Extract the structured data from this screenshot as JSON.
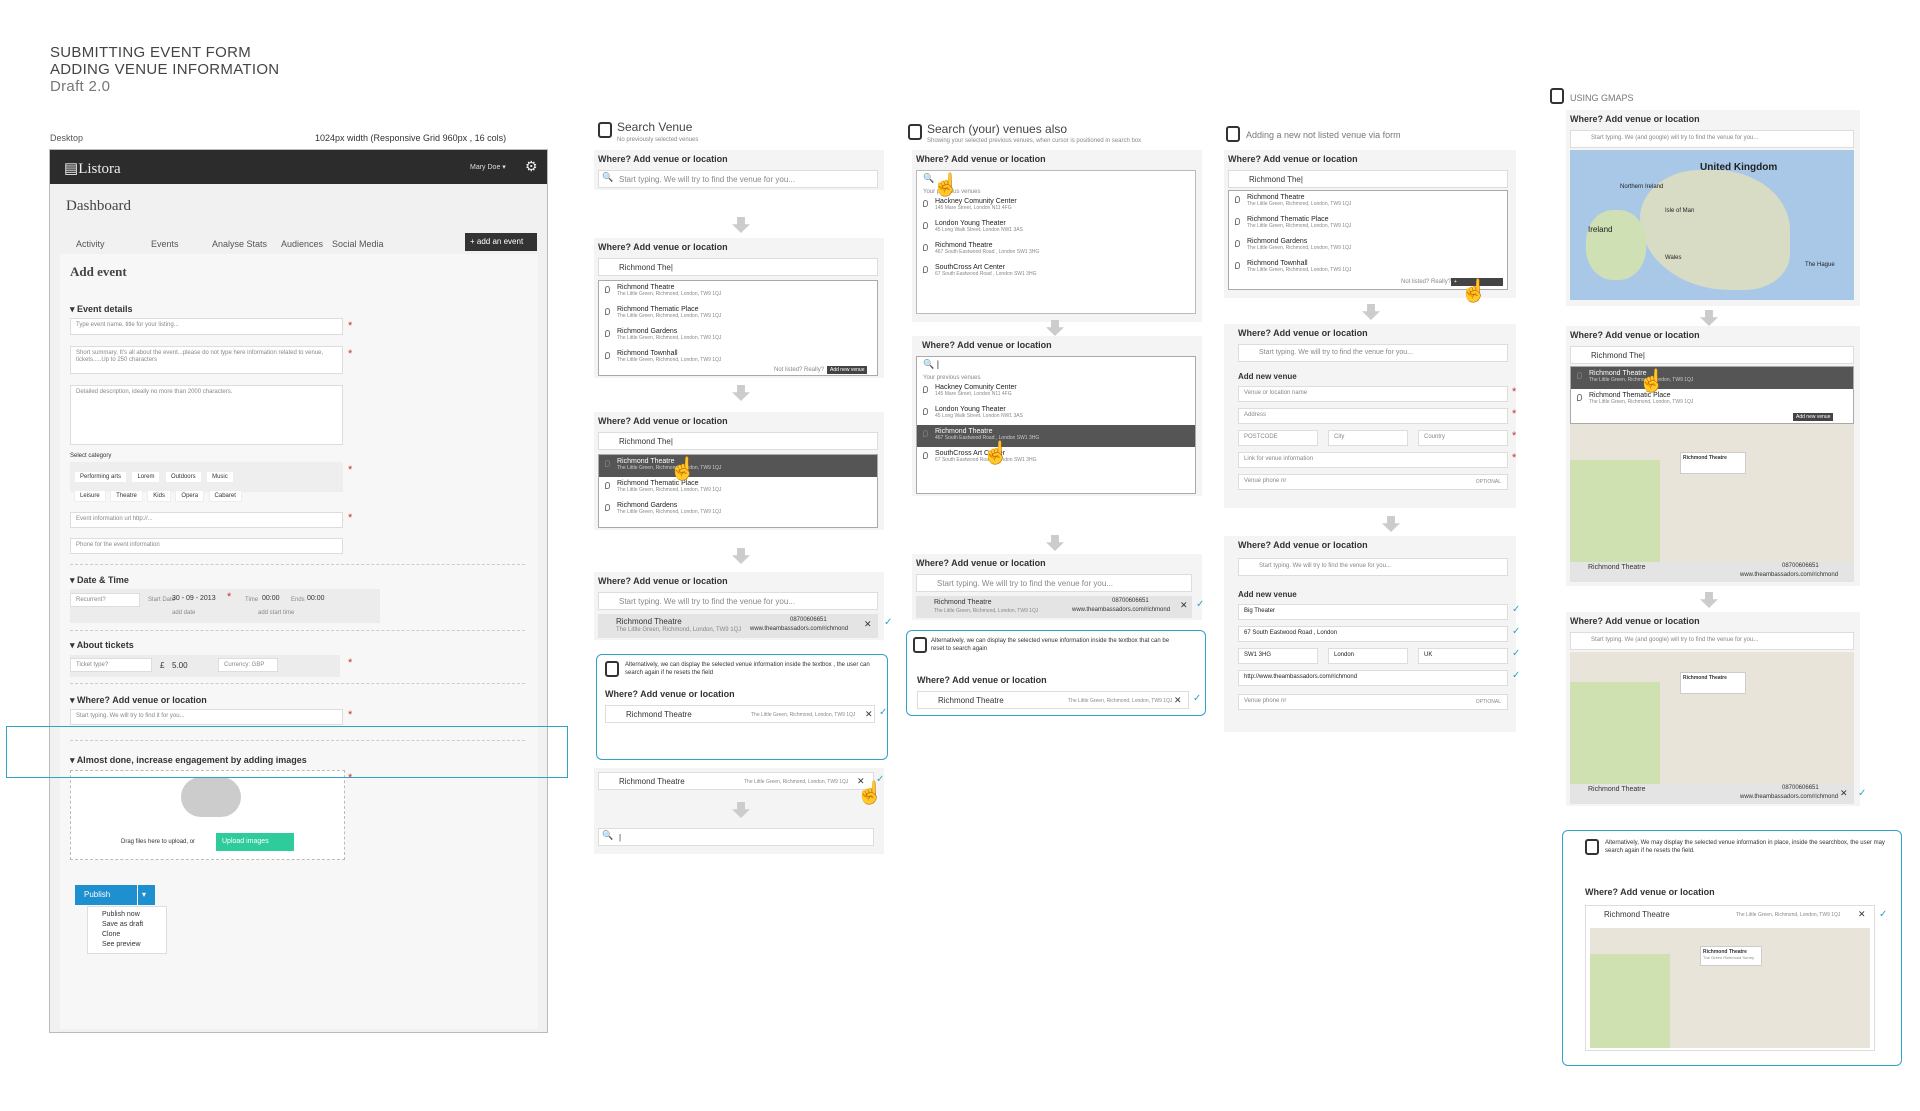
{
  "header": {
    "line1": "SUBMITTING EVENT FORM",
    "line2": "ADDING VENUE INFORMATION",
    "line3": "Draft 2.0"
  },
  "desktop": {
    "label": "Desktop",
    "grid": "1024px width   (Responsive Grid 960px , 16 cols)",
    "logo": "Listora",
    "user": "Mary Doe ▾",
    "title": "Dashboard",
    "tabs": [
      "Activity",
      "Events",
      "Analyse Stats",
      "Audiences",
      "Social Media"
    ],
    "add_event": "add an event",
    "add_event_title": "Add event",
    "event_details": "Event details",
    "title_ph": "Type event name, title for your listing...",
    "summary_ph": "Short summary. It's all about the event...please do not type here information related to venue, tickets.....Up to 250 characters",
    "desc_ph": "Detailed description, ideally no more than 2000 characters.",
    "select_category": "Select category",
    "categories_row1": [
      "Performing arts",
      "Lorem",
      "Outdoors",
      "Music"
    ],
    "categories_row2": [
      "Leisure",
      "Theatre",
      "Kids",
      "Opera",
      "Cabaret"
    ],
    "url_ph": "Event information url http://...",
    "phone_ph": "Phone for the event information",
    "datetime": "Date & Time",
    "recurrent": "Recurrent?",
    "start_date_label": "Start Date",
    "start_date": "30 - 09 - 2013",
    "time_label": "Time",
    "time": "00:00",
    "ends_label": "Ends",
    "ends": "00:00",
    "add_date": "add date",
    "add_start_time": "add start time",
    "about_tickets": "About tickets",
    "ticket_type": "Ticket type?",
    "price_symbol": "£",
    "price": "5.00",
    "currency": "Currency: GBP",
    "venue": "Where? Add venue or location",
    "venue_ph": "Start typing. We will try to find it for you...",
    "images": "Almost done,  increase engagement by adding images",
    "drag": "Drag files here to upload, or",
    "upload": "Upload images",
    "publish": "Publish",
    "menu": [
      "Publish  now",
      "Save as draft",
      "Clone",
      "See preview"
    ]
  },
  "col2": {
    "title": "Search Venue",
    "sub": "No previously selected venues",
    "q": "Where? Add venue or location",
    "ph": "Start typing. We will try to find the venue for you...",
    "typed": "Richmond The|",
    "results": [
      {
        "n": "Richmond Theatre",
        "a": "The Little Green, Richmond, London, TW9 1QJ"
      },
      {
        "n": "Richmond Thematic Place",
        "a": "The Little Green, Richmond, London, TW9 1QJ"
      },
      {
        "n": "Richmond Gardens",
        "a": "The Little Green, Richmond, London, TW9 1QJ"
      },
      {
        "n": "Richmond Townhall",
        "a": "The Little Green, Richmond, London, TW9 1QJ"
      }
    ],
    "not_listed": "Not listed? Really?",
    "add_new": "Add new venue",
    "phone": "08700606651",
    "url": "www.theambassadors.com/richmond",
    "alt": "Alternatively, we can display the selected venue information inside the textbox , the user  can  search again if he resets the field",
    "sel_name": "Richmond Theatre",
    "sel_addr": "The Little Green, Richmond, London, TW9 1QJ"
  },
  "col3": {
    "title": "Search (your) venues also",
    "sub": "Showing your selected previous venues, when cursor is positioned in search box",
    "q": "Where? Add venue or location",
    "your_prev": "Your previous venues",
    "results": [
      {
        "n": "Hackney Comunity Center",
        "a": "145 Mare Street, London N11 4FG"
      },
      {
        "n": "London Young Theater",
        "a": "45 Long Walk Street, London NW1 3AS"
      },
      {
        "n": "Richmond Theatre",
        "a": "467 South Eastwood Road , London  SW1 3HG"
      },
      {
        "n": "SouthCross Art Center",
        "a": "67 South Eastwood Road , London  SW1 3HG"
      }
    ],
    "ph": "Start typing. We will try to find the venue for you...",
    "phone": "08700606651",
    "url": "www.theambassadors.com/richmond",
    "alt": "Alternatively, we can display the selected venue information inside the textbox that can be reset to search again",
    "sel": "Richmond Theatre",
    "sel_addr": "The Little Green, Richmond, London, TW9 1QJ"
  },
  "col4": {
    "title": "Adding a new not listed venue via form",
    "q": "Where? Add venue or location",
    "typed": "Richmond The|",
    "results": [
      "Richmond Theatre",
      "Richmond Thematic Place",
      "Richmond Gardens",
      "Richmond Townhall"
    ],
    "addr": "The Little Green, Richmond, London, TW9 1QJ",
    "not_listed": "Not listed? Really?",
    "ph": "Start typing. We will try to find the venue for you...",
    "add_new_venue": "Add new venue",
    "f_name": "Venue or location name",
    "f_addr": "Address",
    "f_post": "POSTCODE",
    "f_city": "City",
    "f_country": "Country",
    "f_link": "Link for venue information",
    "f_phone": "Venue phone nr",
    "optional": "OPTIONAL",
    "v_name": "Big Theater",
    "v_addr": "67 South Eastwood Road , London",
    "v_post": "SW1 3HG",
    "v_city": "London",
    "v_country": "UK",
    "v_url": "http://www.theambassadors.com/richmond"
  },
  "col5": {
    "title": "USING GMAPS",
    "q": "Where? Add venue or location",
    "ph": "Start typing. We (and google) will try to find the venue for you...",
    "typed": "Richmond The|",
    "map_labels": [
      "United Kingdom",
      "Northern Ireland",
      "Ireland",
      "Wales",
      "Isle of Man",
      "The Hague"
    ],
    "results": [
      "Richmond Theatre",
      "Richmond Thematic Place",
      "Richmond Townhall"
    ],
    "addr": "The Little Green, Richmond, London, TW9 1QJ",
    "add_new": "Add new venue",
    "pop1": "Richmond Theatre",
    "pop2": "The Green Richmond Surrey",
    "sel": "Richmond Theatre",
    "phone": "08700606651",
    "url": "www.theambassadors.com/richmond",
    "alt": "Alternatively, We may display the selected venue information in place,  inside the searchbox, the user may search again if he resets the field.",
    "sel_addr": "The Little Green, Richmond, London, TW9 1QJ"
  },
  "colors": {
    "accent": "#2fa3c7",
    "publish": "#1e8fcf",
    "upload": "#2ecc9a",
    "dark": "#2c2c2c"
  }
}
